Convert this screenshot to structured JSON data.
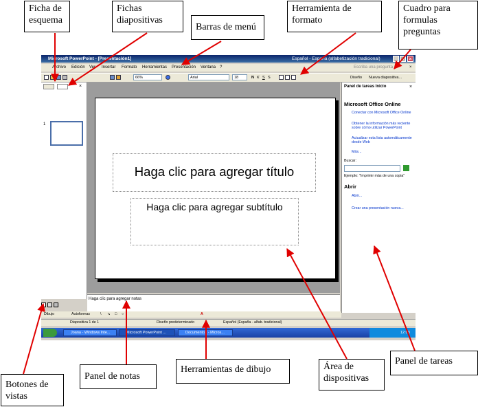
{
  "callouts": {
    "ficha_esquema": "Ficha de esquema",
    "fichas_diapositivas": "Fichas diapositivas",
    "barras_menu": "Barras de menú",
    "herramienta_formato": "Herramienta  de formato",
    "cuadro_formulas": "Cuadro para formulas preguntas",
    "botones_vistas": "Botones de vistas",
    "panel_notas": "Panel de notas",
    "herramientas_dibujo": "Herramientas de dibujo",
    "area_diapositivas": "Área de dispositivas",
    "panel_tareas": "Panel de tareas"
  },
  "window": {
    "title": "Microsoft PowerPoint - [Presentación1]",
    "language": "Español - España (alfabetización tradicional)"
  },
  "menu": [
    "Archivo",
    "Edición",
    "Ver",
    "Insertar",
    "Formato",
    "Herramientas",
    "Presentación",
    "Ventana",
    "?"
  ],
  "question_box": {
    "placeholder": "Escriba una pregunta"
  },
  "toolbar": {
    "zoom": "66%",
    "font": "Arial",
    "size": "18",
    "design_label": "Diseño",
    "new_slide_label": "Nueva diapositiva..."
  },
  "outline": {
    "slide_number": "1"
  },
  "slide": {
    "title_placeholder": "Haga clic para agregar título",
    "subtitle_placeholder": "Haga clic para agregar subtítulo"
  },
  "notes": {
    "placeholder": "Haga clic para agregar notas"
  },
  "taskpane": {
    "header": "Panel de tareas Inicio",
    "section_title": "Microsoft Office Online",
    "links": [
      "Conectar con Microsoft Office Online",
      "Obtener la información más reciente sobre cómo utilizar PowerPoint",
      "Actualizar esta lista automáticamente desde Web"
    ],
    "more": "Más...",
    "search_label": "Buscar:",
    "example": "Ejemplo: \"Imprimir más de una copia\"",
    "open_title": "Abrir",
    "open_more": "Abrir...",
    "create": "Crear una presentación nueva..."
  },
  "drawing": {
    "dibujo_label": "Dibujo",
    "autoformas_label": "Autoformas"
  },
  "status": {
    "slide": "Diapositiva 1 de 1",
    "design": "Diseño predeterminado",
    "language": "Español (España - alfab. tradicional)"
  },
  "taskbar": {
    "items": [
      "Joana - Windows Inte...",
      "Microsoft PowerPoint ...",
      "Documento1 - Micros..."
    ],
    "clock": "12:03"
  },
  "colors": {
    "arrow": "#e00000",
    "titlebar": "#0a246a",
    "taskbar": "#245edb"
  }
}
